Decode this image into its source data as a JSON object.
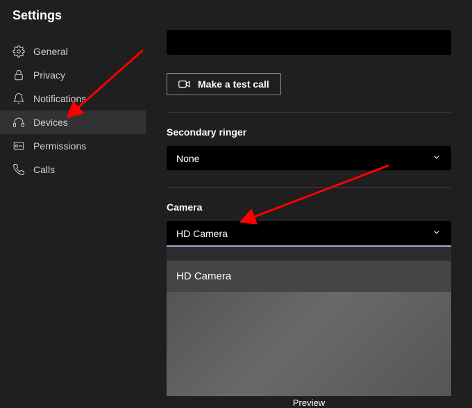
{
  "header": {
    "title": "Settings"
  },
  "sidebar": {
    "items": [
      {
        "label": "General"
      },
      {
        "label": "Privacy"
      },
      {
        "label": "Notifications"
      },
      {
        "label": "Devices"
      },
      {
        "label": "Permissions"
      },
      {
        "label": "Calls"
      }
    ]
  },
  "main": {
    "test_call_label": "Make a test call",
    "secondary_ringer": {
      "label": "Secondary ringer",
      "selected": "None"
    },
    "camera": {
      "label": "Camera",
      "selected": "HD Camera",
      "options": [
        "HD Camera"
      ],
      "preview_label": "Preview"
    }
  },
  "annotations": {
    "arrow1": {
      "color": "#ff0000"
    },
    "arrow2": {
      "color": "#ff0000"
    }
  }
}
